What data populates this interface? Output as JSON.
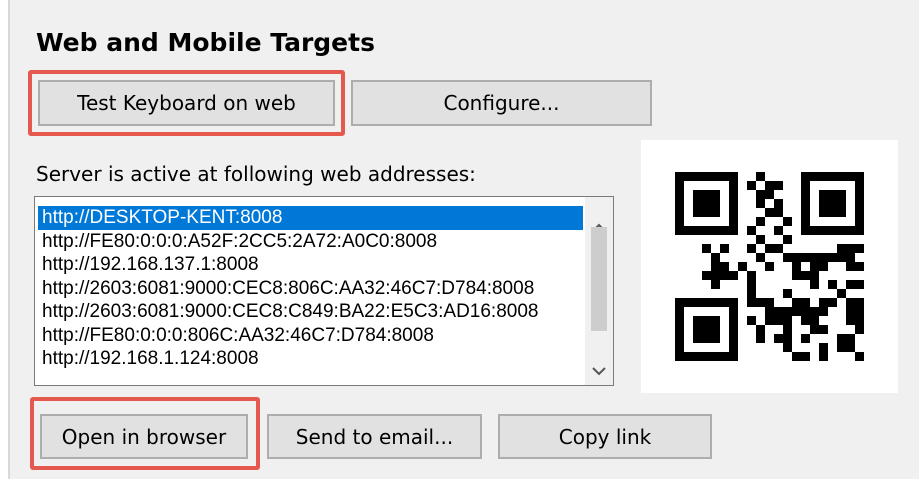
{
  "section": {
    "title": "Web and Mobile Targets"
  },
  "buttons": {
    "test_keyboard": "Test Keyboard on web",
    "configure": "Configure...",
    "open_browser": "Open in browser",
    "send_email": "Send to email...",
    "copy_link": "Copy link"
  },
  "server": {
    "label": "Server is active at following web addresses:",
    "addresses": [
      "http://DESKTOP-KENT:8008",
      "http://FE80:0:0:0:A52F:2CC5:2A72:A0C0:8008",
      "http://192.168.137.1:8008",
      "http://2603:6081:9000:CEC8:806C:AA32:46C7:D784:8008",
      "http://2603:6081:9000:CEC8:C849:BA22:E5C3:AD16:8008",
      "http://FE80:0:0:0:806C:AA32:46C7:D784:8008",
      "http://192.168.1.124:8008"
    ],
    "selected_index": 0
  },
  "icons": {
    "scroll_up": "scroll-up-arrow",
    "scroll_down": "scroll-down-arrow",
    "qr": "qr-code"
  },
  "colors": {
    "highlight": "#e4584e",
    "selection": "#0078d7"
  }
}
